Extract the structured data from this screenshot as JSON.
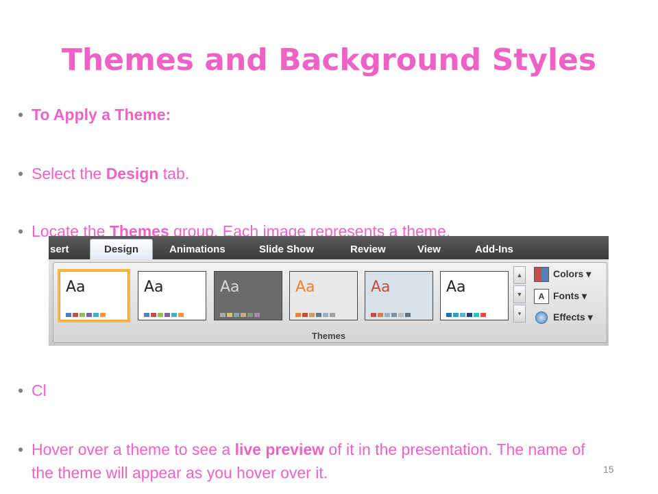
{
  "slide": {
    "title": "Themes and Background Styles",
    "page_number": "15",
    "bullets": [
      {
        "parts": [
          {
            "text": "To Apply a Theme:",
            "bold": true
          }
        ]
      },
      {
        "parts": [
          {
            "text": "Select the ",
            "bold": false
          },
          {
            "text": "Design",
            "bold": true
          },
          {
            "text": " tab.",
            "bold": false
          }
        ]
      },
      {
        "parts": [
          {
            "text": "Locate the ",
            "bold": false
          },
          {
            "text": "Themes",
            "bold": true
          },
          {
            "text": " group.  Each image represents a theme.",
            "bold": false
          }
        ]
      },
      {
        "parts": [
          {
            "text": "Cl",
            "bold": false
          }
        ]
      },
      {
        "parts": [
          {
            "text": "Hover over a theme to see a ",
            "bold": false
          },
          {
            "text": "live preview",
            "bold": true
          },
          {
            "text": " of it in the presentation. The name of the theme will appear as you hover over it.",
            "bold": false
          }
        ]
      }
    ]
  },
  "ribbon": {
    "tabs": [
      "sert",
      "Design",
      "Animations",
      "Slide Show",
      "Review",
      "View",
      "Add-Ins"
    ],
    "active_tab": "Design",
    "group_label": "Themes",
    "theme_thumbs": [
      {
        "label": "Aa",
        "bg": "#ffffff",
        "text_color": "#222222",
        "selected": true,
        "swatches": [
          "#4f81bd",
          "#c0504d",
          "#9bbb59",
          "#8064a2",
          "#4bacc6",
          "#f79646"
        ]
      },
      {
        "label": "Aa",
        "bg": "#ffffff",
        "text_color": "#222222",
        "selected": false,
        "swatches": [
          "#4f81bd",
          "#c0504d",
          "#9bbb59",
          "#8064a2",
          "#4bacc6",
          "#f79646"
        ]
      },
      {
        "label": "Aa",
        "bg": "#6b6b6b",
        "text_color": "#d8d8d8",
        "selected": false,
        "swatches": [
          "#aaaaaa",
          "#d6c37a",
          "#8aa0b8",
          "#c9aa8a",
          "#7c9c7c",
          "#b08aa0"
        ]
      },
      {
        "label": "Aa",
        "bg": "#e8e8e8",
        "text_color": "#f08030",
        "selected": false,
        "swatches": [
          "#f08030",
          "#c05030",
          "#d0a060",
          "#607890",
          "#9bb0c8",
          "#a0a0a0"
        ]
      },
      {
        "label": "Aa",
        "bg": "#d8e0e8",
        "text_color": "#c05040",
        "selected": false,
        "swatches": [
          "#c05040",
          "#d08050",
          "#a0b0c0",
          "#8090a0",
          "#c0c0c0",
          "#607080"
        ]
      },
      {
        "label": "Aa",
        "bg": "#ffffff",
        "text_color": "#222222",
        "selected": false,
        "swatches": [
          "#1f6fbf",
          "#2aa0c8",
          "#5ab0d8",
          "#204080",
          "#30c0c0",
          "#ff4040"
        ]
      }
    ],
    "menu": [
      {
        "label": "Colors ▾",
        "icon": "colors-icon"
      },
      {
        "label": "Fonts ▾",
        "icon": "fonts-icon",
        "glyph": "A"
      },
      {
        "label": "Effects ▾",
        "icon": "effects-icon"
      }
    ]
  }
}
